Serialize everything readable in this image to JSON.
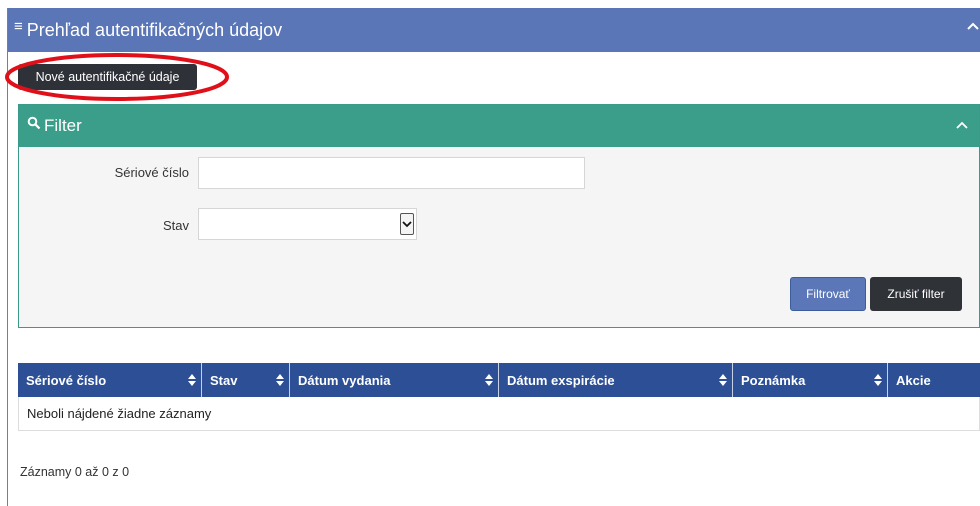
{
  "header": {
    "title": "Prehľad autentifikačných údajov",
    "menu_icon": "hamburger-icon",
    "collapse_icon": "chevron-up-icon"
  },
  "new_button": {
    "label": "Nové autentifikačné údaje"
  },
  "filter": {
    "title": "Filter",
    "serial_label": "Sériové číslo",
    "serial_value": "",
    "state_label": "Stav",
    "state_value": "",
    "filter_button": "Filtrovať",
    "clear_button": "Zrušiť filter"
  },
  "table": {
    "columns": [
      "Sériové číslo",
      "Stav",
      "Dátum vydania",
      "Dátum exspirácie",
      "Poznámka",
      "Akcie"
    ],
    "empty_message": "Neboli nájdené žiadne záznamy"
  },
  "footer": {
    "info": "Záznamy 0 až 0 z 0"
  },
  "colors": {
    "header": "#5a76b6",
    "filter_header": "#3a9e8a",
    "table_header": "#2c4f96",
    "highlight": "#e0101a"
  }
}
